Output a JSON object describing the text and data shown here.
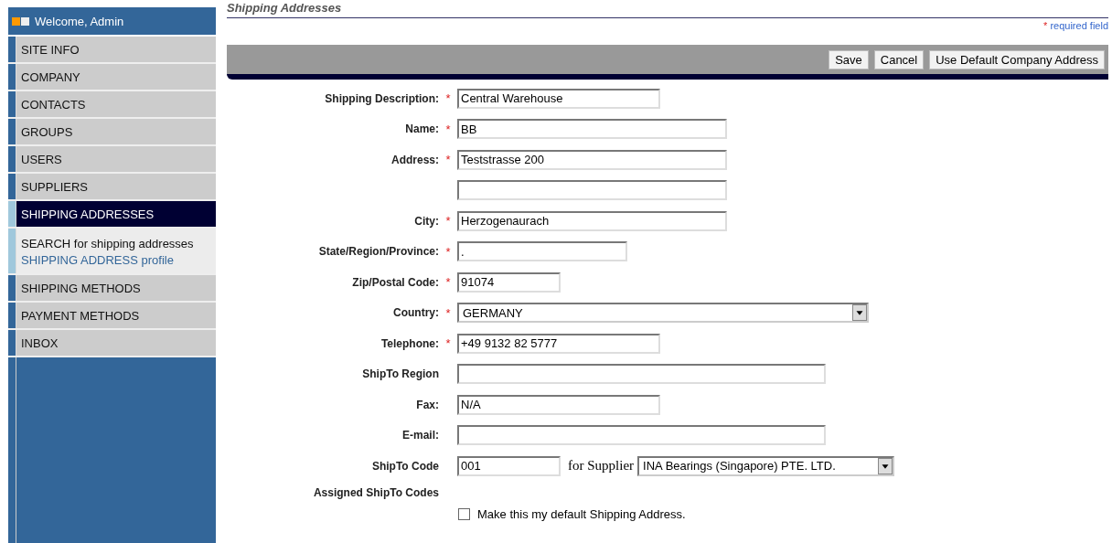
{
  "sidebar": {
    "welcome": "Welcome, Admin",
    "items": [
      {
        "label": "SITE INFO",
        "selected": false
      },
      {
        "label": "COMPANY",
        "selected": false
      },
      {
        "label": "CONTACTS",
        "selected": false
      },
      {
        "label": "GROUPS",
        "selected": false
      },
      {
        "label": "USERS",
        "selected": false
      },
      {
        "label": "SUPPLIERS",
        "selected": false
      },
      {
        "label": "SHIPPING ADDRESSES",
        "selected": true,
        "children": [
          {
            "label": "SEARCH for shipping addresses",
            "selected": false
          },
          {
            "label": "SHIPPING ADDRESS profile",
            "selected": true
          }
        ]
      },
      {
        "label": "SHIPPING METHODS",
        "selected": false
      },
      {
        "label": "PAYMENT METHODS",
        "selected": false
      },
      {
        "label": "INBOX",
        "selected": false
      }
    ]
  },
  "page": {
    "title": "Shipping Addresses",
    "required_note": "required field",
    "required_mark": "*"
  },
  "toolbar": {
    "buttons": [
      "Save",
      "Cancel",
      "Use Default Company Address"
    ]
  },
  "form": {
    "fields": [
      {
        "kind": "text",
        "label": "Shipping Description:",
        "required": true,
        "value": "Central Warehouse"
      },
      {
        "kind": "text",
        "label": "Name:",
        "required": true,
        "value": "BB"
      },
      {
        "kind": "text",
        "label": "Address:",
        "required": true,
        "value": "Teststrasse 200"
      },
      {
        "kind": "text",
        "required": false
      },
      {
        "kind": "text",
        "label": "City:",
        "required": true,
        "value": "Herzogenaurach"
      },
      {
        "kind": "text",
        "label": "State/Region/Province:",
        "required": true,
        "value": "."
      },
      {
        "kind": "text",
        "label": "Zip/Postal Code:",
        "required": true,
        "value": "91074"
      },
      {
        "kind": "select",
        "label": "Country:",
        "required": true,
        "value": "GERMANY"
      },
      {
        "kind": "text",
        "label": "Telephone:",
        "required": true,
        "value": "+49 9132 82 5777"
      },
      {
        "kind": "text",
        "label": "ShipTo Region",
        "required": false
      },
      {
        "kind": "text",
        "label": "Fax:",
        "required": false,
        "value": "N/A"
      },
      {
        "kind": "text",
        "label": "E-mail:",
        "required": false
      },
      {
        "kind": "code",
        "label": "ShipTo Code",
        "required": false,
        "value": "001",
        "joiner": "for Supplier",
        "supplier": "INA Bearings (Singapore) PTE. LTD."
      },
      {
        "kind": "heading",
        "label": "Assigned ShipTo Codes",
        "required": false
      }
    ],
    "default_checkbox": {
      "label": "Make this my default Shipping Address.",
      "checked": false
    }
  }
}
